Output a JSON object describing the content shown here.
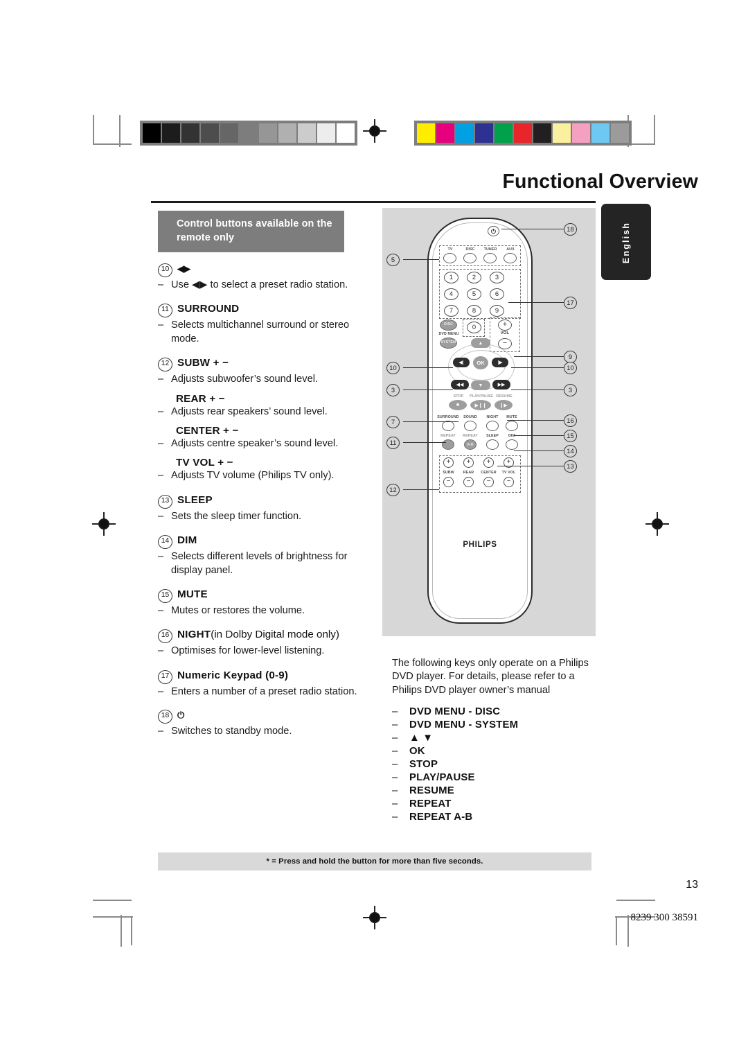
{
  "page": {
    "title": "Functional Overview",
    "language_tab": "English",
    "page_number": "13",
    "document_number": "8239 300 38591",
    "footnote": "* = Press and hold the button for more than five seconds."
  },
  "left_column": {
    "section_heading": "Control buttons available on the remote only",
    "entries": [
      {
        "num": "10",
        "title": "◀▶",
        "title_is_glyph": true,
        "lines": [
          "Use ◀▶ to select a preset radio station."
        ]
      },
      {
        "num": "11",
        "title": "SURROUND",
        "lines": [
          "Selects multichannel surround or stereo mode."
        ]
      },
      {
        "num": "12",
        "title": "SUBW + −",
        "lines": [
          "Adjusts subwoofer’s sound level."
        ]
      },
      {
        "num": "",
        "title": "REAR + −",
        "lines": [
          "Adjusts rear speakers’ sound level."
        ]
      },
      {
        "num": "",
        "title": "CENTER + −",
        "lines": [
          "Adjusts centre speaker’s sound level."
        ]
      },
      {
        "num": "",
        "title": "TV VOL + −",
        "lines": [
          "Adjusts TV volume (Philips TV only)."
        ]
      },
      {
        "num": "13",
        "title": "SLEEP",
        "lines": [
          "Sets the sleep timer function."
        ]
      },
      {
        "num": "14",
        "title": "DIM",
        "lines": [
          "Selects different levels of brightness for display panel."
        ]
      },
      {
        "num": "15",
        "title": "MUTE",
        "lines": [
          "Mutes or restores the volume."
        ]
      },
      {
        "num": "16",
        "title": "NIGHT",
        "title_suffix": " (in Dolby Digital mode only)",
        "lines": [
          "Optimises for lower-level listening."
        ]
      },
      {
        "num": "17",
        "title": "Numeric Keypad (0-9)",
        "lines": [
          "Enters a number of a preset radio station."
        ]
      },
      {
        "num": "18",
        "title": "⏻",
        "title_is_glyph": true,
        "lines": [
          "Switches to standby mode."
        ]
      }
    ]
  },
  "right_column": {
    "intro": "The following keys only operate on a Philips DVD player. For details, please refer to a Philips DVD player owner’s manual",
    "keys": [
      "DVD MENU - DISC",
      "DVD MENU - SYSTEM",
      "▲ ▼",
      "OK",
      "STOP",
      "PLAY/PAUSE",
      "RESUME",
      "REPEAT",
      "REPEAT A-B"
    ],
    "key_dash": "–"
  },
  "remote": {
    "brand": "PHILIPS",
    "source_buttons": [
      "TV",
      "DISC",
      "TUNER",
      "AUX"
    ],
    "numeric_keys": [
      "1",
      "2",
      "3",
      "4",
      "5",
      "6",
      "7",
      "8",
      "9",
      "0"
    ],
    "menu_buttons": [
      {
        "label": "DISC",
        "caption": "DVD MENU"
      },
      {
        "label": "SYSTEM",
        "caption": ""
      }
    ],
    "vol_label": "VOL",
    "vol_plus": "+",
    "vol_minus": "−",
    "ok_label": "OK",
    "transport_labels": [
      "STOP",
      "PLAY/PAUSE",
      "RESUME"
    ],
    "feature_row1": [
      "SURROUND",
      "SOUND",
      "NIGHT",
      "MUTE"
    ],
    "feature_row2": [
      "REPEAT",
      "REPEAT",
      "SLEEP",
      "DIM"
    ],
    "repeat_ab_label": "A-B",
    "level_labels": [
      "SUBW",
      "REAR",
      "CENTER",
      "TV VOL"
    ],
    "level_plus": "+",
    "level_minus": "−",
    "callouts_left": [
      "5",
      "10",
      "3",
      "7",
      "11",
      "12"
    ],
    "callouts_right": [
      "18",
      "17",
      "9",
      "10",
      "3",
      "16",
      "15",
      "14",
      "13"
    ]
  },
  "calibration": {
    "grayscale": [
      "#000000",
      "#1c1c1c",
      "#333333",
      "#4d4d4d",
      "#666666",
      "#7d7d7d",
      "#969696",
      "#b0b0b0",
      "#cccccc",
      "#ededed",
      "#ffffff"
    ],
    "colors": [
      "#ffed00",
      "#e6007e",
      "#00a0e3",
      "#2e3192",
      "#00a14b",
      "#e8252a",
      "#231f20",
      "#faf0a0",
      "#f4a0c0",
      "#6ec9f2",
      "#9b9b9b"
    ]
  }
}
